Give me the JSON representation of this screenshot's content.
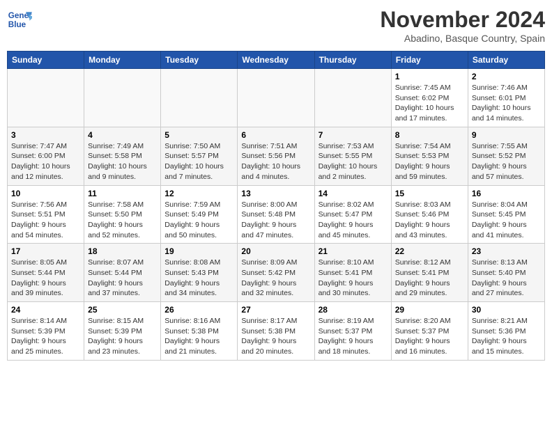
{
  "logo": {
    "line1": "General",
    "line2": "Blue"
  },
  "title": "November 2024",
  "location": "Abadino, Basque Country, Spain",
  "days_of_week": [
    "Sunday",
    "Monday",
    "Tuesday",
    "Wednesday",
    "Thursday",
    "Friday",
    "Saturday"
  ],
  "weeks": [
    [
      {
        "day": "",
        "info": ""
      },
      {
        "day": "",
        "info": ""
      },
      {
        "day": "",
        "info": ""
      },
      {
        "day": "",
        "info": ""
      },
      {
        "day": "",
        "info": ""
      },
      {
        "day": "1",
        "info": "Sunrise: 7:45 AM\nSunset: 6:02 PM\nDaylight: 10 hours and 17 minutes."
      },
      {
        "day": "2",
        "info": "Sunrise: 7:46 AM\nSunset: 6:01 PM\nDaylight: 10 hours and 14 minutes."
      }
    ],
    [
      {
        "day": "3",
        "info": "Sunrise: 7:47 AM\nSunset: 6:00 PM\nDaylight: 10 hours and 12 minutes."
      },
      {
        "day": "4",
        "info": "Sunrise: 7:49 AM\nSunset: 5:58 PM\nDaylight: 10 hours and 9 minutes."
      },
      {
        "day": "5",
        "info": "Sunrise: 7:50 AM\nSunset: 5:57 PM\nDaylight: 10 hours and 7 minutes."
      },
      {
        "day": "6",
        "info": "Sunrise: 7:51 AM\nSunset: 5:56 PM\nDaylight: 10 hours and 4 minutes."
      },
      {
        "day": "7",
        "info": "Sunrise: 7:53 AM\nSunset: 5:55 PM\nDaylight: 10 hours and 2 minutes."
      },
      {
        "day": "8",
        "info": "Sunrise: 7:54 AM\nSunset: 5:53 PM\nDaylight: 9 hours and 59 minutes."
      },
      {
        "day": "9",
        "info": "Sunrise: 7:55 AM\nSunset: 5:52 PM\nDaylight: 9 hours and 57 minutes."
      }
    ],
    [
      {
        "day": "10",
        "info": "Sunrise: 7:56 AM\nSunset: 5:51 PM\nDaylight: 9 hours and 54 minutes."
      },
      {
        "day": "11",
        "info": "Sunrise: 7:58 AM\nSunset: 5:50 PM\nDaylight: 9 hours and 52 minutes."
      },
      {
        "day": "12",
        "info": "Sunrise: 7:59 AM\nSunset: 5:49 PM\nDaylight: 9 hours and 50 minutes."
      },
      {
        "day": "13",
        "info": "Sunrise: 8:00 AM\nSunset: 5:48 PM\nDaylight: 9 hours and 47 minutes."
      },
      {
        "day": "14",
        "info": "Sunrise: 8:02 AM\nSunset: 5:47 PM\nDaylight: 9 hours and 45 minutes."
      },
      {
        "day": "15",
        "info": "Sunrise: 8:03 AM\nSunset: 5:46 PM\nDaylight: 9 hours and 43 minutes."
      },
      {
        "day": "16",
        "info": "Sunrise: 8:04 AM\nSunset: 5:45 PM\nDaylight: 9 hours and 41 minutes."
      }
    ],
    [
      {
        "day": "17",
        "info": "Sunrise: 8:05 AM\nSunset: 5:44 PM\nDaylight: 9 hours and 39 minutes."
      },
      {
        "day": "18",
        "info": "Sunrise: 8:07 AM\nSunset: 5:44 PM\nDaylight: 9 hours and 37 minutes."
      },
      {
        "day": "19",
        "info": "Sunrise: 8:08 AM\nSunset: 5:43 PM\nDaylight: 9 hours and 34 minutes."
      },
      {
        "day": "20",
        "info": "Sunrise: 8:09 AM\nSunset: 5:42 PM\nDaylight: 9 hours and 32 minutes."
      },
      {
        "day": "21",
        "info": "Sunrise: 8:10 AM\nSunset: 5:41 PM\nDaylight: 9 hours and 30 minutes."
      },
      {
        "day": "22",
        "info": "Sunrise: 8:12 AM\nSunset: 5:41 PM\nDaylight: 9 hours and 29 minutes."
      },
      {
        "day": "23",
        "info": "Sunrise: 8:13 AM\nSunset: 5:40 PM\nDaylight: 9 hours and 27 minutes."
      }
    ],
    [
      {
        "day": "24",
        "info": "Sunrise: 8:14 AM\nSunset: 5:39 PM\nDaylight: 9 hours and 25 minutes."
      },
      {
        "day": "25",
        "info": "Sunrise: 8:15 AM\nSunset: 5:39 PM\nDaylight: 9 hours and 23 minutes."
      },
      {
        "day": "26",
        "info": "Sunrise: 8:16 AM\nSunset: 5:38 PM\nDaylight: 9 hours and 21 minutes."
      },
      {
        "day": "27",
        "info": "Sunrise: 8:17 AM\nSunset: 5:38 PM\nDaylight: 9 hours and 20 minutes."
      },
      {
        "day": "28",
        "info": "Sunrise: 8:19 AM\nSunset: 5:37 PM\nDaylight: 9 hours and 18 minutes."
      },
      {
        "day": "29",
        "info": "Sunrise: 8:20 AM\nSunset: 5:37 PM\nDaylight: 9 hours and 16 minutes."
      },
      {
        "day": "30",
        "info": "Sunrise: 8:21 AM\nSunset: 5:36 PM\nDaylight: 9 hours and 15 minutes."
      }
    ]
  ]
}
